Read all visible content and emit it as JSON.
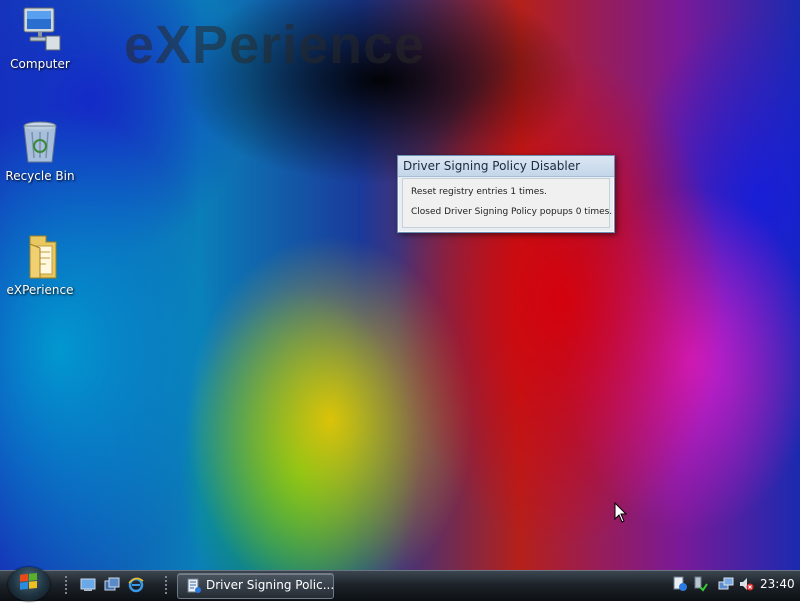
{
  "desktop": {
    "watermark_text": "eXPerience",
    "icons": [
      {
        "label": "Computer",
        "icon": "computer-icon"
      },
      {
        "label": "Recycle Bin",
        "icon": "recycle-bin-icon"
      },
      {
        "label": "eXPerience",
        "icon": "folder-icon"
      }
    ]
  },
  "popup": {
    "title": "Driver Signing Policy Disabler",
    "line1": "Reset registry entries 1 times.",
    "line2": "Closed Driver Signing Policy popups 0 times."
  },
  "taskbar": {
    "start_icon": "windows-start-orb-icon",
    "quick_launch": [
      "show-desktop-icon",
      "switch-windows-icon",
      "internet-explorer-icon"
    ],
    "task_button_label": "Driver Signing Polic...",
    "task_button_icon": "driver-app-icon",
    "tray_icons": [
      "driver-signing-tray-icon",
      "safely-remove-tray-icon",
      "network-icon",
      "volume-muted-icon"
    ],
    "clock": "23:40"
  },
  "colors": {
    "popup_title_bg": "#c5d6ea",
    "taskbar_bg": "#1d232a"
  }
}
